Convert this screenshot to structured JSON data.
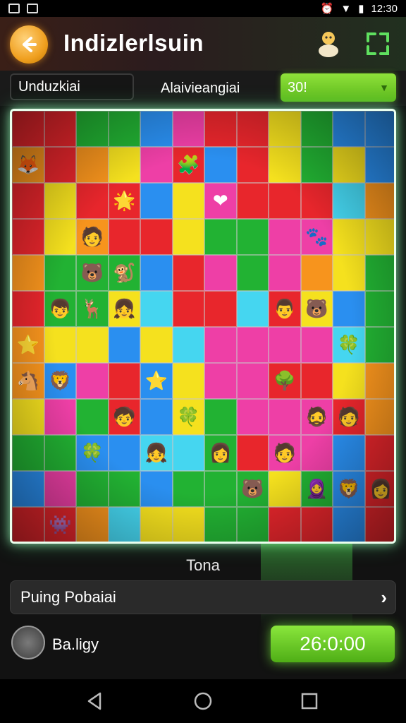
{
  "status_bar": {
    "time": "12:30"
  },
  "header": {
    "title": "Indizlerlsuin"
  },
  "controls": {
    "field_value": "Unduzkiai",
    "mid_label": "Alaivieangiai",
    "dropdown_value": "30!"
  },
  "board": {
    "rows": 12,
    "cols": 12,
    "palette": {
      "R": "#e8262c",
      "Y": "#f5e11e",
      "G": "#22b233",
      "B": "#2a8ff0",
      "P": "#ee3fa6",
      "O": "#f7941d",
      "C": "#45d6f0",
      "L": "#8ed63a"
    },
    "cells": [
      "RRGGBPRRYGBB",
      "OROYPRBRYGYB",
      "RYRRBYPRRRCO",
      "RYORRYGGPPYY",
      "OGGGBRPGPOYG",
      "RGGYCRRCRYBG",
      "OYYBYCPPPPCG",
      "OBPRBYPPRRYO",
      "YPGRBYGPPPRO",
      "GGBBCCGRPPBR",
      "BPGGBGGGYGBR",
      "RROCYYGGRRBR"
    ],
    "glyphs": {
      "1-1": "🦊",
      "1-6": "🧩",
      "2-4": "🌟",
      "2-7": "❤",
      "3-3": "🧑",
      "3-10": "🐾",
      "4-3": "🐻",
      "4-4": "🐒",
      "5-2": "👦",
      "5-3": "🦌",
      "5-4": "👧",
      "5-9": "👨",
      "5-10": "🐻",
      "6-1": "⭐",
      "6-11": "🍀",
      "7-1": "🐴",
      "7-2": "🦁",
      "7-5": "⭐",
      "7-9": "🌳",
      "8-0": "👩",
      "8-4": "🧒",
      "8-6": "🍀",
      "8-10": "🧔",
      "8-11": "🧑",
      "9-3": "🍀",
      "9-5": "👧",
      "9-7": "👩",
      "9-9": "🧑",
      "10-8": "🐻",
      "10-10": "🧕",
      "10-11": "🦁",
      "10-12": "👩",
      "11-2": "👾"
    }
  },
  "total_label": "Tona",
  "play_row": {
    "label": "Puing Pobaiai"
  },
  "bottom": {
    "label": "Ba.ligy",
    "timer": "26:0:00"
  }
}
